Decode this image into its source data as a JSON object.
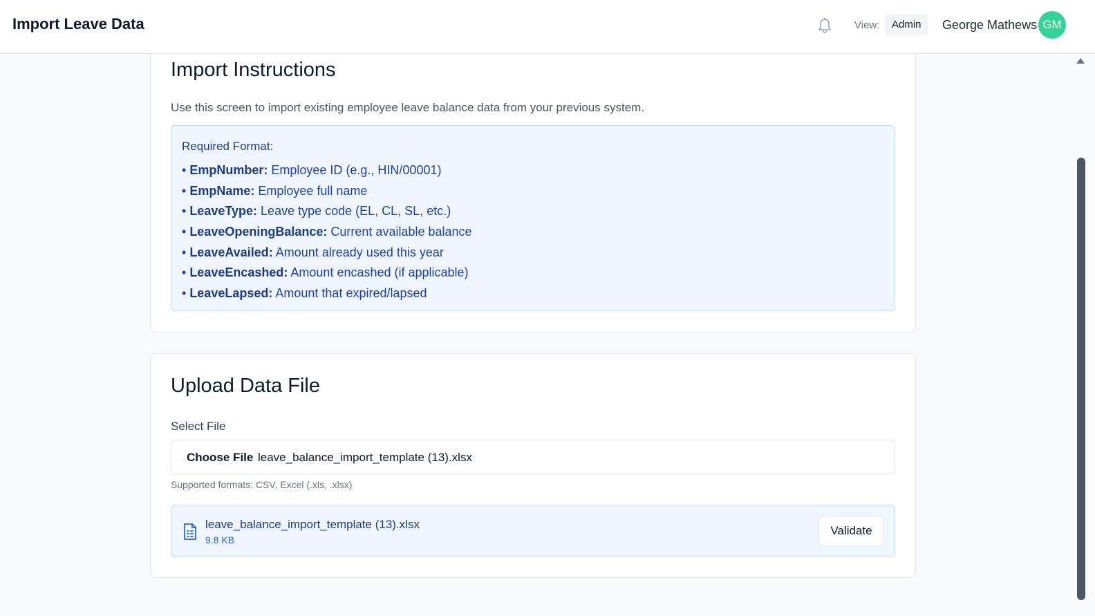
{
  "header": {
    "title": "Import Leave Data",
    "bell_icon": "bell-icon",
    "view_label": "View:",
    "view_value": "Admin",
    "user_name": "George Mathews",
    "avatar_initials": "GM",
    "avatar_color": "#34d399"
  },
  "instructions": {
    "title": "Import Instructions",
    "intro": "Use this screen to import existing employee leave balance data from your previous system.",
    "format_heading": "Required Format:",
    "fields": [
      {
        "name": "EmpNumber:",
        "desc": "Employee ID (e.g., HIN/00001)"
      },
      {
        "name": "EmpName:",
        "desc": "Employee full name"
      },
      {
        "name": "LeaveType:",
        "desc": "Leave type code (EL, CL, SL, etc.)"
      },
      {
        "name": "LeaveOpeningBalance:",
        "desc": "Current available balance"
      },
      {
        "name": "LeaveAvailed:",
        "desc": "Amount already used this year"
      },
      {
        "name": "LeaveEncashed:",
        "desc": "Amount encashed (if applicable)"
      },
      {
        "name": "LeaveLapsed:",
        "desc": "Amount that expired/lapsed"
      }
    ]
  },
  "upload": {
    "title": "Upload Data File",
    "select_label": "Select File",
    "choose_button": "Choose File",
    "chosen_file": "leave_balance_import_template (13).xlsx",
    "formats_hint": "Supported formats: CSV, Excel (.xls, .xlsx)",
    "selected_file": {
      "icon": "file-spreadsheet-icon",
      "name": "leave_balance_import_template (13).xlsx",
      "size": "9.8 KB"
    },
    "validate_button": "Validate"
  },
  "colors": {
    "accent": "#1e3a8a",
    "info_bg": "#eff6ff",
    "info_border": "#bfdbfe"
  }
}
